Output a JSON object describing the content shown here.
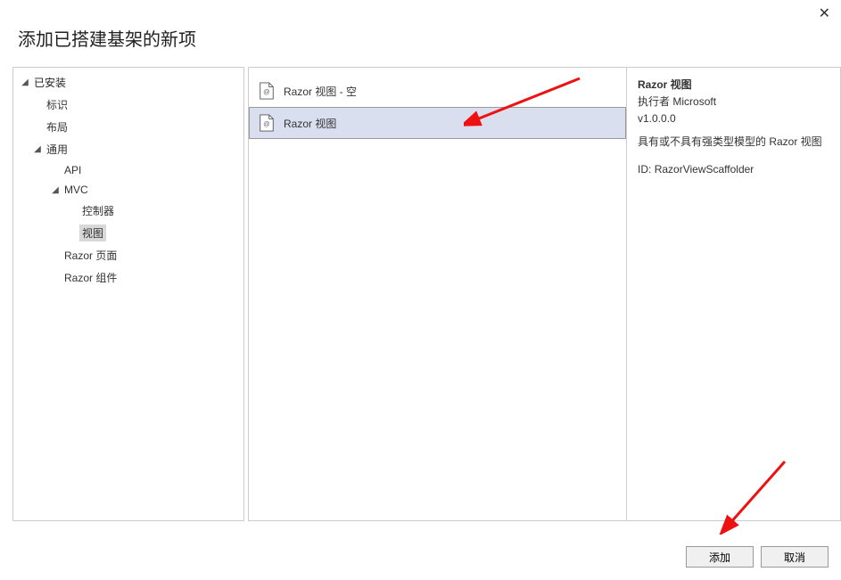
{
  "dialog": {
    "title": "添加已搭建基架的新项"
  },
  "tree": {
    "header": "已安装",
    "items": [
      {
        "label": "标识",
        "level": 1,
        "expanded": false
      },
      {
        "label": "布局",
        "level": 1,
        "expanded": false
      },
      {
        "label": "通用",
        "level": 1,
        "expanded": true
      },
      {
        "label": "API",
        "level": 2,
        "expanded": false
      },
      {
        "label": "MVC",
        "level": 2,
        "expanded": true
      },
      {
        "label": "控制器",
        "level": 3,
        "expanded": false
      },
      {
        "label": "视图",
        "level": 3,
        "expanded": false,
        "selected": true
      },
      {
        "label": "Razor 页面",
        "level": 2,
        "expanded": false
      },
      {
        "label": "Razor 组件",
        "level": 2,
        "expanded": false
      }
    ]
  },
  "list": {
    "items": [
      {
        "label": "Razor 视图 - 空",
        "selected": false
      },
      {
        "label": "Razor 视图",
        "selected": true
      }
    ]
  },
  "details": {
    "title": "Razor 视图",
    "publisher_label": "执行者",
    "publisher": "Microsoft",
    "version": "v1.0.0.0",
    "description": "具有或不具有强类型模型的 Razor 视图",
    "id_label": "ID:",
    "id": "RazorViewScaffolder"
  },
  "buttons": {
    "add": "添加",
    "cancel": "取消"
  }
}
